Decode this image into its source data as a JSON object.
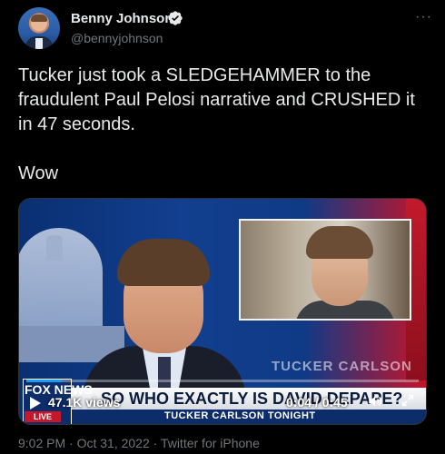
{
  "author": {
    "name": "Benny Johnson",
    "handle": "@bennyjohnson",
    "verified": true,
    "avatar_icon": "profile-photo"
  },
  "more_label": "···",
  "tweet": {
    "text": "Tucker just took a SLEDGEHAMMER to the fraudulent Paul Pelosi narrative and CRUSHED it in 47 seconds.\n\nWow"
  },
  "video": {
    "chyron_headline": "SO WHO EXACTLY IS DAVID DEPAPE?",
    "chyron_show": "TUCKER CARLSON TONIGHT",
    "network": "FOX NEWS",
    "live_label": "LIVE",
    "watermark": "TUCKER CARLSON",
    "views": "47.1K views",
    "time": "0:04 / 0:45",
    "progress_fraction": 0.09,
    "accent_color": "#1d9bf0"
  },
  "footer": {
    "meta": "9:02 PM · Oct 31, 2022 · Twitter for iPhone"
  }
}
